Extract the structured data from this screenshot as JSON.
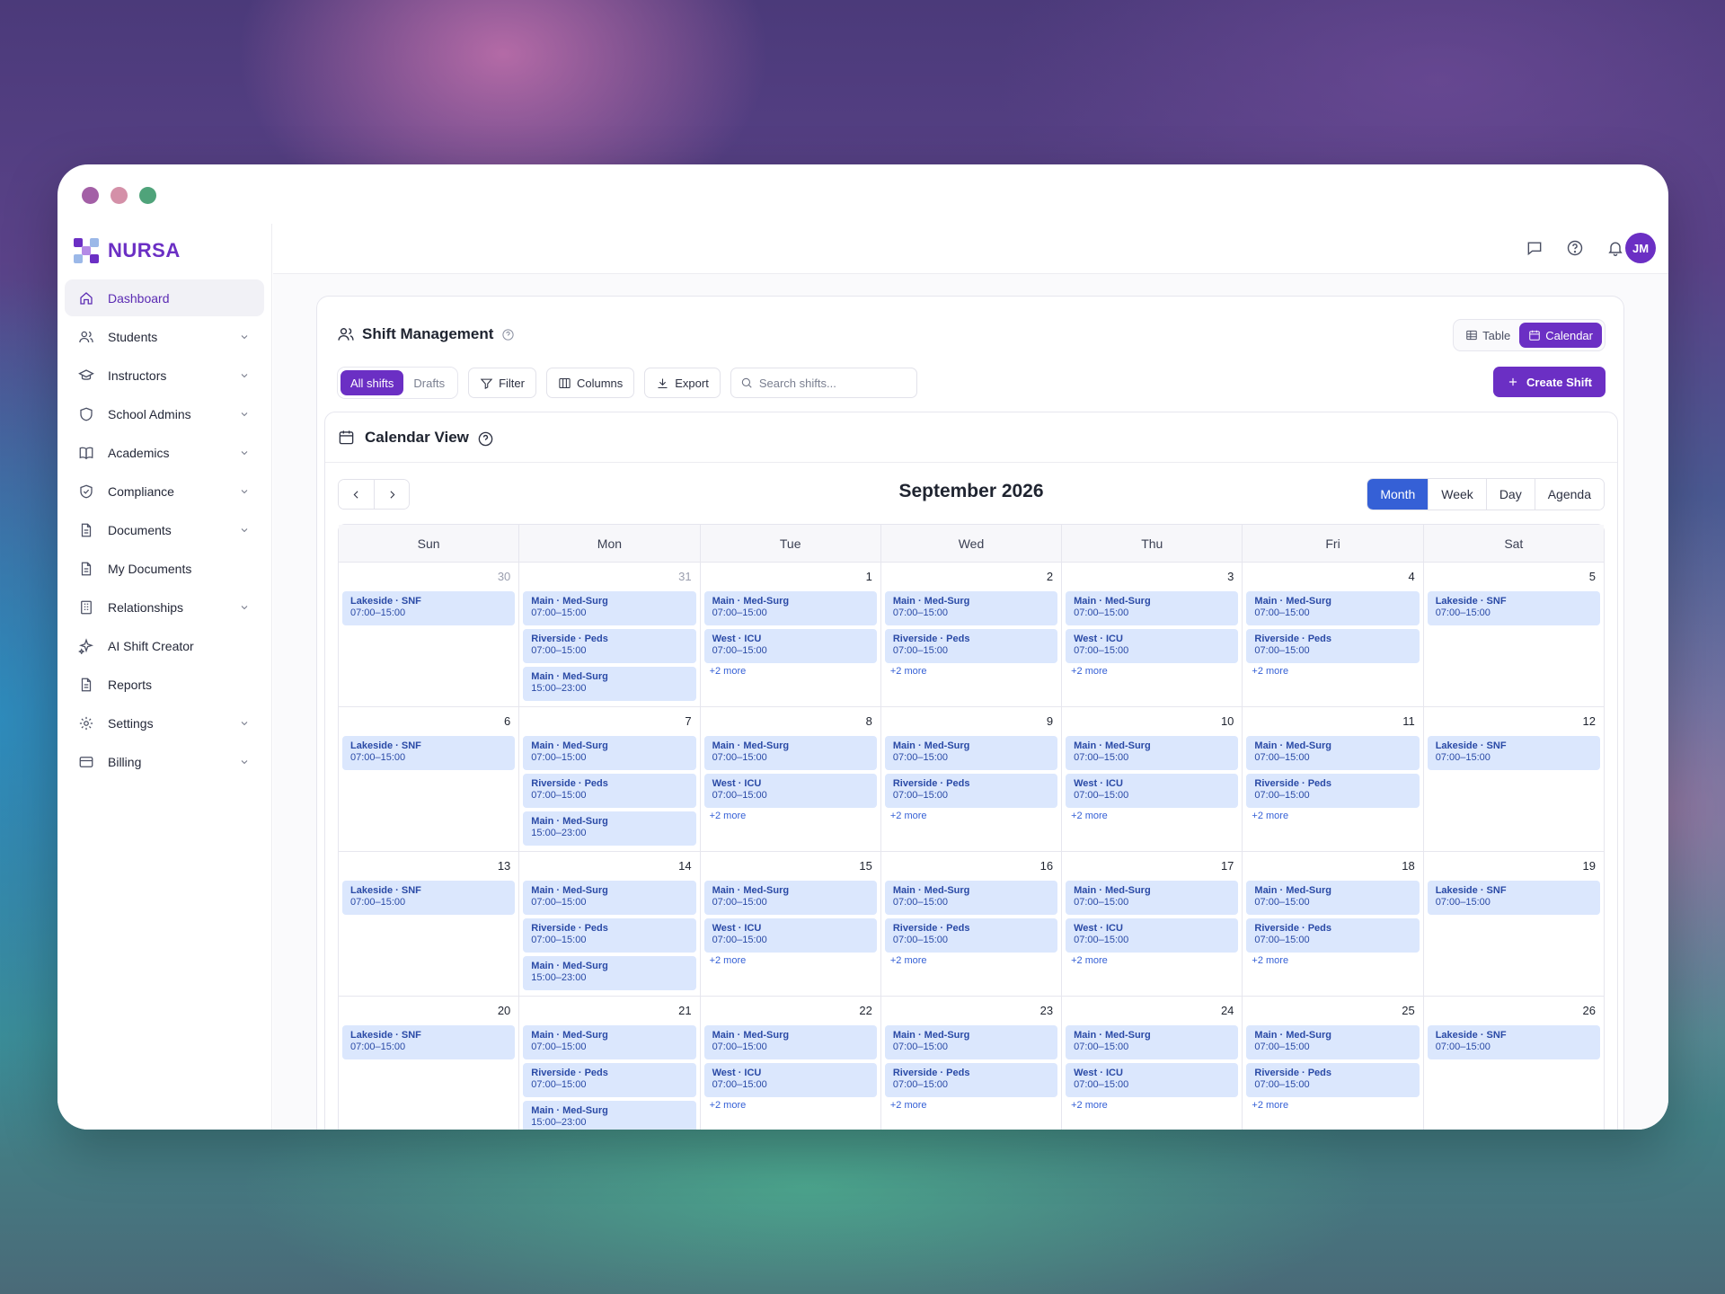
{
  "brand": {
    "name": "NURSA"
  },
  "sidebar": {
    "items": [
      {
        "label": "Dashboard",
        "icon": "home-icon",
        "active": true,
        "expandable": false
      },
      {
        "label": "Students",
        "icon": "users-icon",
        "expandable": true
      },
      {
        "label": "Instructors",
        "icon": "graduation-cap-icon",
        "expandable": true
      },
      {
        "label": "School Admins",
        "icon": "shield-icon",
        "expandable": true
      },
      {
        "label": "Academics",
        "icon": "book-open-icon",
        "expandable": true
      },
      {
        "label": "Compliance",
        "icon": "shield-check-icon",
        "expandable": true
      },
      {
        "label": "Documents",
        "icon": "document-icon",
        "expandable": true
      },
      {
        "label": "My Documents",
        "icon": "document-icon",
        "expandable": false
      },
      {
        "label": "Relationships",
        "icon": "building-icon",
        "expandable": true
      },
      {
        "label": "AI Shift Creator",
        "icon": "sparkles-icon",
        "expandable": false
      },
      {
        "label": "Reports",
        "icon": "document-icon",
        "expandable": false
      },
      {
        "label": "Settings",
        "icon": "gear-icon",
        "expandable": true
      },
      {
        "label": "Billing",
        "icon": "credit-card-icon",
        "expandable": true
      }
    ]
  },
  "topbar": {
    "avatar_initials": "JM"
  },
  "panel": {
    "title": "Shift Management",
    "view_toggle": {
      "table_label": "Table",
      "calendar_label": "Calendar",
      "selected": "Calendar"
    },
    "filters": {
      "all_label": "All shifts",
      "drafts_label": "Drafts",
      "filter_label": "Filter",
      "columns_label": "Columns",
      "export_label": "Export",
      "search_placeholder": "Search shifts...",
      "create_label": "Create Shift"
    }
  },
  "calendar": {
    "title": "Calendar View",
    "month_label": "September 2026",
    "ranges": [
      "Month",
      "Week",
      "Day",
      "Agenda"
    ],
    "selected_range": "Month",
    "weekdays": [
      "Sun",
      "Mon",
      "Tue",
      "Wed",
      "Thu",
      "Fri",
      "Sat"
    ],
    "weeks": [
      [
        {
          "day": "30",
          "other": true,
          "events": [
            [
              "Lakeside · SNF",
              "07:00–15:00"
            ]
          ]
        },
        {
          "day": "31",
          "other": true,
          "events": [
            [
              "Main · Med-Surg",
              "07:00–15:00"
            ],
            [
              "Riverside · Peds",
              "07:00–15:00"
            ],
            [
              "Main · Med-Surg",
              "15:00–23:00"
            ]
          ]
        },
        {
          "day": "1",
          "events": [
            [
              "Main · Med-Surg",
              "07:00–15:00"
            ],
            [
              "West · ICU",
              "07:00–15:00"
            ]
          ],
          "more": "+2 more"
        },
        {
          "day": "2",
          "events": [
            [
              "Main · Med-Surg",
              "07:00–15:00"
            ],
            [
              "Riverside · Peds",
              "07:00–15:00"
            ]
          ],
          "more": "+2 more"
        },
        {
          "day": "3",
          "events": [
            [
              "Main · Med-Surg",
              "07:00–15:00"
            ],
            [
              "West · ICU",
              "07:00–15:00"
            ]
          ],
          "more": "+2 more"
        },
        {
          "day": "4",
          "events": [
            [
              "Main · Med-Surg",
              "07:00–15:00"
            ],
            [
              "Riverside · Peds",
              "07:00–15:00"
            ]
          ],
          "more": "+2 more"
        },
        {
          "day": "5",
          "events": [
            [
              "Lakeside · SNF",
              "07:00–15:00"
            ]
          ]
        }
      ],
      [
        {
          "day": "6",
          "events": [
            [
              "Lakeside · SNF",
              "07:00–15:00"
            ]
          ]
        },
        {
          "day": "7",
          "events": [
            [
              "Main · Med-Surg",
              "07:00–15:00"
            ],
            [
              "Riverside · Peds",
              "07:00–15:00"
            ],
            [
              "Main · Med-Surg",
              "15:00–23:00"
            ]
          ]
        },
        {
          "day": "8",
          "events": [
            [
              "Main · Med-Surg",
              "07:00–15:00"
            ],
            [
              "West · ICU",
              "07:00–15:00"
            ]
          ],
          "more": "+2 more"
        },
        {
          "day": "9",
          "events": [
            [
              "Main · Med-Surg",
              "07:00–15:00"
            ],
            [
              "Riverside · Peds",
              "07:00–15:00"
            ]
          ],
          "more": "+2 more"
        },
        {
          "day": "10",
          "events": [
            [
              "Main · Med-Surg",
              "07:00–15:00"
            ],
            [
              "West · ICU",
              "07:00–15:00"
            ]
          ],
          "more": "+2 more"
        },
        {
          "day": "11",
          "events": [
            [
              "Main · Med-Surg",
              "07:00–15:00"
            ],
            [
              "Riverside · Peds",
              "07:00–15:00"
            ]
          ],
          "more": "+2 more"
        },
        {
          "day": "12",
          "events": [
            [
              "Lakeside · SNF",
              "07:00–15:00"
            ]
          ]
        }
      ],
      [
        {
          "day": "13",
          "events": [
            [
              "Lakeside · SNF",
              "07:00–15:00"
            ]
          ]
        },
        {
          "day": "14",
          "events": [
            [
              "Main · Med-Surg",
              "07:00–15:00"
            ],
            [
              "Riverside · Peds",
              "07:00–15:00"
            ],
            [
              "Main · Med-Surg",
              "15:00–23:00"
            ]
          ]
        },
        {
          "day": "15",
          "events": [
            [
              "Main · Med-Surg",
              "07:00–15:00"
            ],
            [
              "West · ICU",
              "07:00–15:00"
            ]
          ],
          "more": "+2 more"
        },
        {
          "day": "16",
          "events": [
            [
              "Main · Med-Surg",
              "07:00–15:00"
            ],
            [
              "Riverside · Peds",
              "07:00–15:00"
            ]
          ],
          "more": "+2 more"
        },
        {
          "day": "17",
          "events": [
            [
              "Main · Med-Surg",
              "07:00–15:00"
            ],
            [
              "West · ICU",
              "07:00–15:00"
            ]
          ],
          "more": "+2 more"
        },
        {
          "day": "18",
          "events": [
            [
              "Main · Med-Surg",
              "07:00–15:00"
            ],
            [
              "Riverside · Peds",
              "07:00–15:00"
            ]
          ],
          "more": "+2 more"
        },
        {
          "day": "19",
          "events": [
            [
              "Lakeside · SNF",
              "07:00–15:00"
            ]
          ]
        }
      ],
      [
        {
          "day": "20",
          "events": [
            [
              "Lakeside · SNF",
              "07:00–15:00"
            ]
          ]
        },
        {
          "day": "21",
          "events": [
            [
              "Main · Med-Surg",
              "07:00–15:00"
            ],
            [
              "Riverside · Peds",
              "07:00–15:00"
            ],
            [
              "Main · Med-Surg",
              "15:00–23:00"
            ]
          ]
        },
        {
          "day": "22",
          "events": [
            [
              "Main · Med-Surg",
              "07:00–15:00"
            ],
            [
              "West · ICU",
              "07:00–15:00"
            ]
          ],
          "more": "+2 more"
        },
        {
          "day": "23",
          "events": [
            [
              "Main · Med-Surg",
              "07:00–15:00"
            ],
            [
              "Riverside · Peds",
              "07:00–15:00"
            ]
          ],
          "more": "+2 more"
        },
        {
          "day": "24",
          "events": [
            [
              "Main · Med-Surg",
              "07:00–15:00"
            ],
            [
              "West · ICU",
              "07:00–15:00"
            ]
          ],
          "more": "+2 more"
        },
        {
          "day": "25",
          "events": [
            [
              "Main · Med-Surg",
              "07:00–15:00"
            ],
            [
              "Riverside · Peds",
              "07:00–15:00"
            ]
          ],
          "more": "+2 more"
        },
        {
          "day": "26",
          "events": [
            [
              "Lakeside · SNF",
              "07:00–15:00"
            ]
          ]
        }
      ]
    ]
  },
  "colors": {
    "brand": "#6b2fc4",
    "accent_blue": "#3560d6",
    "event_bg": "#dbe7fd",
    "event_text": "#2a4aa6"
  }
}
